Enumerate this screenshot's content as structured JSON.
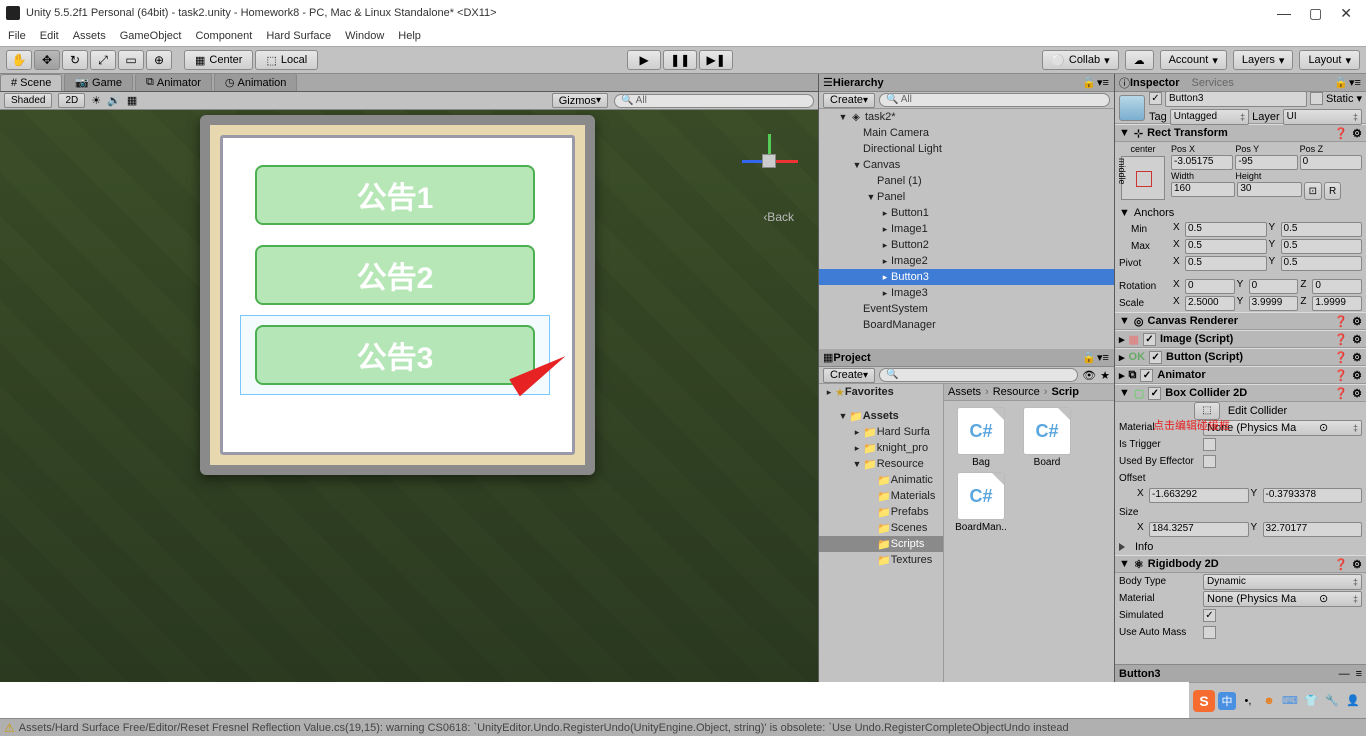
{
  "titlebar": {
    "title": "Unity 5.5.2f1 Personal (64bit) - task2.unity - Homework8 - PC, Mac & Linux Standalone* <DX11>"
  },
  "menu": [
    "File",
    "Edit",
    "Assets",
    "GameObject",
    "Component",
    "Hard Surface",
    "Window",
    "Help"
  ],
  "toolbar": {
    "center": "Center",
    "local": "Local",
    "collab": "Collab",
    "account": "Account",
    "layers": "Layers",
    "layout": "Layout"
  },
  "sceneTabs": {
    "scene": "Scene",
    "game": "Game",
    "animator": "Animator",
    "animation": "Animation"
  },
  "sceneStrip": {
    "shaded": "Shaded",
    "mode2d": "2D",
    "gizmos": "Gizmos",
    "searchPlaceholder": "All"
  },
  "sceneOverlay": {
    "back": "‹Back",
    "btn1": "公告1",
    "btn2": "公告2",
    "btn3": "公告3"
  },
  "hierarchy": {
    "title": "Hierarchy",
    "create": "Create",
    "searchPlaceholder": "All",
    "items": [
      {
        "label": "task2*",
        "depth": 0,
        "icon": "◈",
        "expand": "▼"
      },
      {
        "label": "Main Camera",
        "depth": 1
      },
      {
        "label": "Directional Light",
        "depth": 1
      },
      {
        "label": "Canvas",
        "depth": 1,
        "expand": "▼"
      },
      {
        "label": "Panel (1)",
        "depth": 2
      },
      {
        "label": "Panel",
        "depth": 2,
        "expand": "▼"
      },
      {
        "label": "Button1",
        "depth": 3,
        "expand": "▸"
      },
      {
        "label": "Image1",
        "depth": 3,
        "expand": "▸"
      },
      {
        "label": "Button2",
        "depth": 3,
        "expand": "▸"
      },
      {
        "label": "Image2",
        "depth": 3,
        "expand": "▸"
      },
      {
        "label": "Button3",
        "depth": 3,
        "expand": "▸",
        "selected": true
      },
      {
        "label": "Image3",
        "depth": 3,
        "expand": "▸"
      },
      {
        "label": "EventSystem",
        "depth": 1
      },
      {
        "label": "BoardManager",
        "depth": 1
      }
    ]
  },
  "project": {
    "title": "Project",
    "create": "Create",
    "favorites": "Favorites",
    "tree": [
      {
        "label": "Assets",
        "depth": 0,
        "expand": "▼",
        "bold": true
      },
      {
        "label": "Hard Surfa",
        "depth": 1,
        "expand": "▸"
      },
      {
        "label": "knight_pro",
        "depth": 1,
        "expand": "▸"
      },
      {
        "label": "Resource",
        "depth": 1,
        "expand": "▼"
      },
      {
        "label": "Animatic",
        "depth": 2
      },
      {
        "label": "Materials",
        "depth": 2
      },
      {
        "label": "Prefabs",
        "depth": 2
      },
      {
        "label": "Scenes",
        "depth": 2
      },
      {
        "label": "Scripts",
        "depth": 2,
        "selected": true
      },
      {
        "label": "Textures",
        "depth": 2
      }
    ],
    "breadcrumb": [
      "Assets",
      "Resource",
      "Scrip"
    ],
    "files": [
      {
        "name": "Bag",
        "type": "C#"
      },
      {
        "name": "Board",
        "type": "C#"
      },
      {
        "name": "BoardMan..",
        "type": "C#"
      }
    ]
  },
  "inspector": {
    "title": "Inspector",
    "services": "Services",
    "name": "Button3",
    "staticLabel": "Static",
    "tagLabel": "Tag",
    "tag": "Untagged",
    "layerLabel": "Layer",
    "layer": "UI",
    "rectTransform": {
      "title": "Rect Transform",
      "centerLabel": "center",
      "middleLabel": "middle",
      "posXLabel": "Pos X",
      "posYLabel": "Pos Y",
      "posZLabel": "Pos Z",
      "posX": "-3.05175",
      "posY": "-95",
      "posZ": "0",
      "widthLabel": "Width",
      "heightLabel": "Height",
      "width": "160",
      "height": "30",
      "anchorsLabel": "Anchors",
      "minLabel": "Min",
      "maxLabel": "Max",
      "minX": "0.5",
      "minY": "0.5",
      "maxX": "0.5",
      "maxY": "0.5",
      "pivotLabel": "Pivot",
      "pivotX": "0.5",
      "pivotY": "0.5",
      "rotationLabel": "Rotation",
      "rotX": "0",
      "rotY": "0",
      "rotZ": "0",
      "scaleLabel": "Scale",
      "scaleX": "2.5000",
      "scaleY": "3.9999",
      "scaleZ": "1.9999",
      "btnR": "R"
    },
    "components": {
      "canvasRenderer": "Canvas Renderer",
      "image": "Image (Script)",
      "button": "Button (Script)",
      "animator": "Animator",
      "boxCollider": "Box Collider 2D",
      "rigidbody": "Rigidbody 2D"
    },
    "boxCollider": {
      "editCollider": "Edit Collider",
      "materialLabel": "Material",
      "material": "None (Physics Ma",
      "isTriggerLabel": "Is Trigger",
      "usedByLabel": "Used By Effector",
      "offsetLabel": "Offset",
      "offsetX": "-1.663292",
      "offsetY": "-0.3793378",
      "sizeLabel": "Size",
      "sizeX": "184.3257",
      "sizeY": "32.70177",
      "infoLabel": "Info",
      "redNote": "点击编辑碰撞框"
    },
    "rigidbody": {
      "bodyTypeLabel": "Body Type",
      "bodyType": "Dynamic",
      "materialLabel": "Material",
      "material": "None (Physics Ma",
      "simulatedLabel": "Simulated",
      "useAutoMassLabel": "Use Auto Mass"
    },
    "bottomTab": "Button3"
  },
  "status": {
    "warning": "Assets/Hard Surface Free/Editor/Reset Fresnel Reflection Value.cs(19,15): warning CS0618: `UnityEditor.Undo.RegisterUndo(UnityEngine.Object, string)' is obsolete: `Use Undo.RegisterCompleteObjectUndo instead"
  },
  "tray": {
    "lang": "中"
  }
}
